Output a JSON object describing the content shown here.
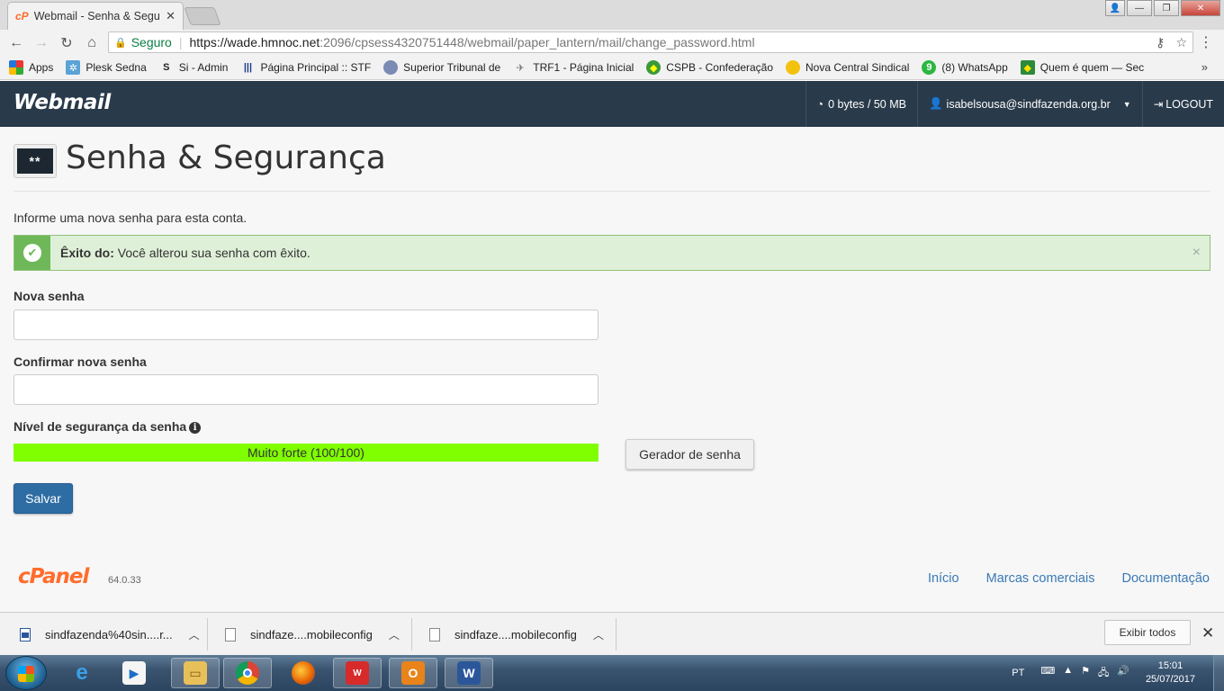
{
  "browser": {
    "tab_title": "Webmail - Senha & Segu",
    "tab_favicon": "cP",
    "secure_label": "Seguro",
    "url_host": "https://wade.hmnoc.net",
    "url_rest": ":2096/cpsess4320751448/webmail/paper_lantern/mail/change_password.html"
  },
  "bookmarks": [
    {
      "label": "Apps",
      "icon": "apps-grid-icon"
    },
    {
      "label": "Plesk Sedna",
      "icon": "plesk-icon"
    },
    {
      "label": "Si - Admin",
      "icon": "si-admin-icon"
    },
    {
      "label": "Página Principal :: STF",
      "icon": "stf-icon"
    },
    {
      "label": "Superior Tribunal de",
      "icon": "stj-icon"
    },
    {
      "label": "TRF1 - Página Inicial",
      "icon": "trf1-icon"
    },
    {
      "label": "CSPB - Confederação",
      "icon": "cspb-icon"
    },
    {
      "label": "Nova Central Sindical",
      "icon": "ncst-icon"
    },
    {
      "label": "(8) WhatsApp",
      "icon": "whatsapp-icon"
    },
    {
      "label": "Quem é quem — Sec",
      "icon": "quem-icon"
    }
  ],
  "header": {
    "logo": "Webmail",
    "quota": "0 bytes / 50 MB",
    "user": "isabelsousa@sindfazenda.org.br",
    "logout": "LOGOUT"
  },
  "page": {
    "title": "Senha & Segurança",
    "icon_text": "**",
    "intro": "Informe uma nova senha para esta conta.",
    "alert_strong": "Êxito do:",
    "alert_text": " Você alterou sua senha com êxito.",
    "alert_dismiss": "×",
    "new_password_label": "Nova senha",
    "new_password_value": "",
    "confirm_password_label": "Confirmar nova senha",
    "confirm_password_value": "",
    "strength_label": "Nível de segurança da senha",
    "strength_text": "Muito forte (100/100)",
    "strength_value": 100,
    "strength_color": "#80ff00",
    "generator_button": "Gerador de senha",
    "save_button": "Salvar"
  },
  "footer": {
    "brand": "cPanel",
    "version": "64.0.33",
    "links": [
      "Início",
      "Marcas comerciais",
      "Documentação"
    ]
  },
  "downloads": {
    "items": [
      "sindfazenda%40sin....r...",
      "sindfaze....mobileconfig",
      "sindfaze....mobileconfig"
    ],
    "show_all": "Exibir todos"
  },
  "taskbar": {
    "lang": "PT",
    "time": "15:01",
    "date": "25/07/2017"
  },
  "colors": {
    "header_bg": "#293a4a",
    "alert_bg": "#dff0d8",
    "save_button": "#2e6da4",
    "link": "#3979b5",
    "cpanel": "#ff6c2c"
  }
}
